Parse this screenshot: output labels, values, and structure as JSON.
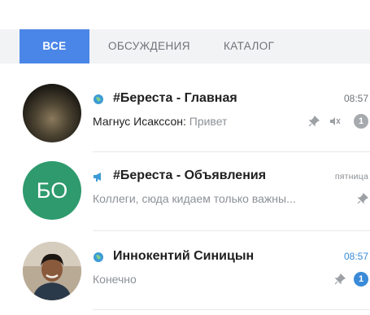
{
  "tabs": [
    {
      "label": "ВСЕ",
      "active": true
    },
    {
      "label": "ОБСУЖДЕНИЯ",
      "active": false
    },
    {
      "label": "КАТАЛОГ",
      "active": false
    }
  ],
  "chats": [
    {
      "type_icon": "globe-icon",
      "title": "#Береста - Главная",
      "time": "08:57",
      "sender": "Магнус Исакссон:",
      "message": "Привет",
      "pinned": true,
      "muted": true,
      "unread": "1",
      "avatar": "photo-dark"
    },
    {
      "type_icon": "megaphone-icon",
      "title": "#Береста - Объявления",
      "time": "пятница",
      "sender": "",
      "message": "Коллеги, сюда кидаем только важны...",
      "pinned": true,
      "muted": false,
      "unread": "",
      "avatar_initials": "БО",
      "avatar_color": "#2e9a6d"
    },
    {
      "type_icon": "globe-icon",
      "title": "Иннокентий Синицын",
      "time": "08:57",
      "sender": "",
      "message": "Конечно",
      "pinned": true,
      "muted": false,
      "unread": "1",
      "avatar": "photo-person"
    }
  ],
  "colors": {
    "accent": "#4a86e8",
    "unread_blue": "#3a8ad8",
    "unread_grey": "#a6a9ad",
    "tab_bar": "#f2f3f5"
  }
}
